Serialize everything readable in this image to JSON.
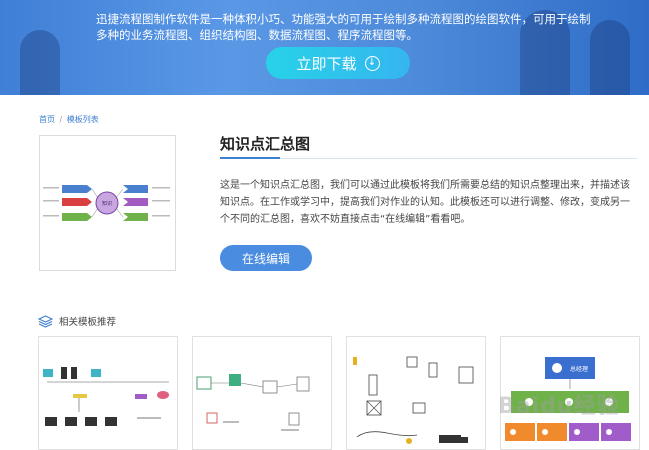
{
  "banner": {
    "text": "迅捷流程图制作软件是一种体积小巧、功能强大的可用于绘制多种流程图的绘图软件，可用于绘制多种的业务流程图、组织结构图、数据流程图、程序流程图等。",
    "download_label": "立即下载"
  },
  "breadcrumb": {
    "home": "首页",
    "separator": "/",
    "current": "模板列表"
  },
  "template": {
    "title": "知识点汇总图",
    "description": "这是一个知识点汇总图，我们可以通过此模板将我们所需要总结的知识点整理出来，并描述该知识点。在工作或学习中，提高我们对作业的认知。此模板还可以进行调整、修改，变成另一个不同的汇总图，喜欢不妨直接点击“在线编辑”看看吧。",
    "edit_label": "在线编辑",
    "preview_center": "知识"
  },
  "related": {
    "title": "相关模板推荐",
    "card4_top": "总经理"
  },
  "watermark": "Baidu经验",
  "colors": {
    "accent": "#3d7fd1",
    "button": "#4a8de0",
    "download": "#2cc8ea"
  }
}
